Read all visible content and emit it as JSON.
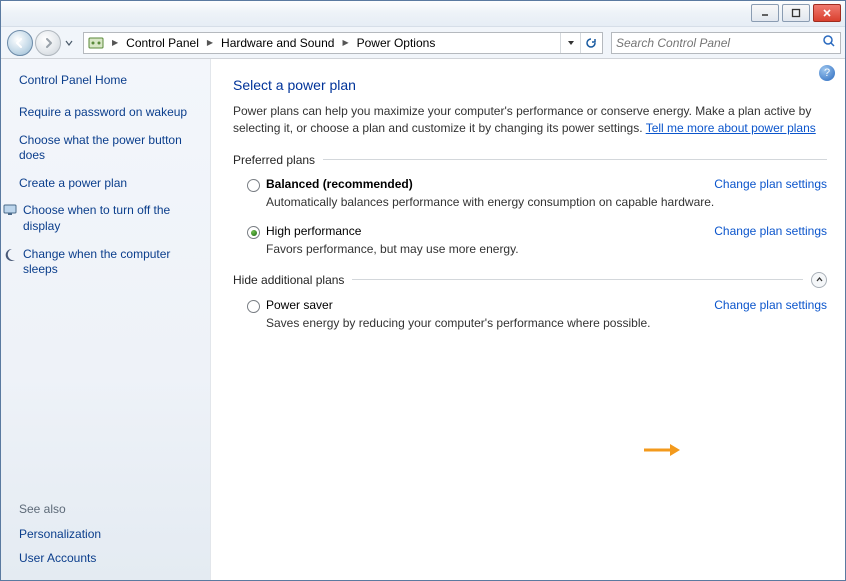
{
  "breadcrumbs": [
    "Control Panel",
    "Hardware and Sound",
    "Power Options"
  ],
  "search": {
    "placeholder": "Search Control Panel"
  },
  "left": {
    "home": "Control Panel Home",
    "tasks": [
      {
        "label": "Require a password on wakeup",
        "icon": null
      },
      {
        "label": "Choose what the power button does",
        "icon": null
      },
      {
        "label": "Create a power plan",
        "icon": null
      },
      {
        "label": "Choose when to turn off the display",
        "icon": "monitor"
      },
      {
        "label": "Change when the computer sleeps",
        "icon": "moon"
      }
    ],
    "seealso_header": "See also",
    "seealso": [
      "Personalization",
      "User Accounts"
    ]
  },
  "main": {
    "title": "Select a power plan",
    "intro_a": "Power plans can help you maximize your computer's performance or conserve energy. Make a plan active by selecting it, or choose a plan and customize it by changing its power settings. ",
    "intro_link": "Tell me more about power plans",
    "preferred_header": "Preferred plans",
    "additional_header": "Hide additional plans",
    "change_settings_label": "Change plan settings",
    "plans_preferred": [
      {
        "name": "Balanced (recommended)",
        "desc": "Automatically balances performance with energy consumption on capable hardware.",
        "bold": true,
        "selected": false
      },
      {
        "name": "High performance",
        "desc": "Favors performance, but may use more energy.",
        "bold": false,
        "selected": true
      }
    ],
    "plans_additional": [
      {
        "name": "Power saver",
        "desc": "Saves energy by reducing your computer's performance where possible.",
        "bold": false,
        "selected": false
      }
    ]
  }
}
